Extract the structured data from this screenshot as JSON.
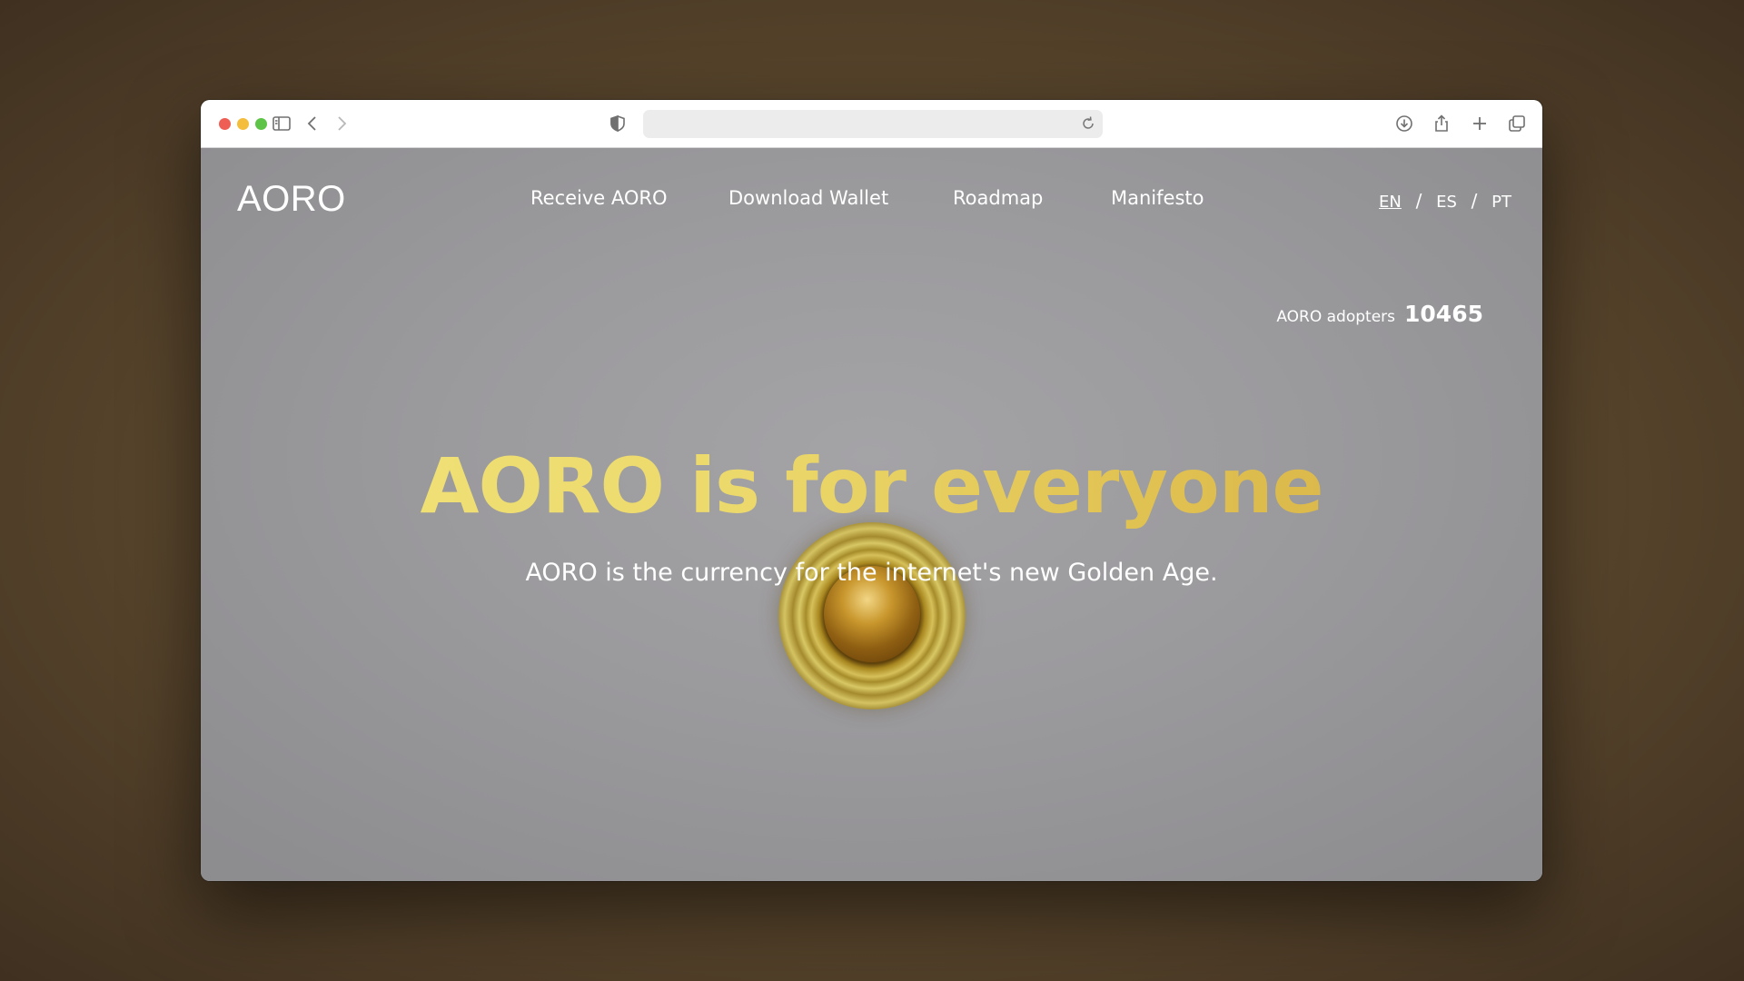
{
  "site": {
    "logo": "AORO",
    "nav": [
      {
        "label": "Receive AORO"
      },
      {
        "label": "Download Wallet"
      },
      {
        "label": "Roadmap"
      },
      {
        "label": "Manifesto"
      }
    ],
    "languages": [
      {
        "code": "EN",
        "active": true
      },
      {
        "code": "ES",
        "active": false
      },
      {
        "code": "PT",
        "active": false
      }
    ],
    "language_separator": "/",
    "adopters": {
      "label": "AORO adopters",
      "count": "10465"
    },
    "hero": {
      "headline": "AORO is for everyone",
      "subheadline": "AORO is the currency for the internet's new Golden Age."
    }
  },
  "browser": {
    "icons": [
      "sidebar-icon",
      "back-icon",
      "forward-icon",
      "privacy-shield-icon",
      "reload-icon",
      "download-icon",
      "share-icon",
      "new-tab-icon",
      "tabs-overview-icon"
    ],
    "url_value": ""
  },
  "colors": {
    "headline_start": "#f1e47a",
    "headline_end": "#d6ae43",
    "page_background": "#9a9a9c",
    "desktop_background": "#5e4a2f"
  }
}
